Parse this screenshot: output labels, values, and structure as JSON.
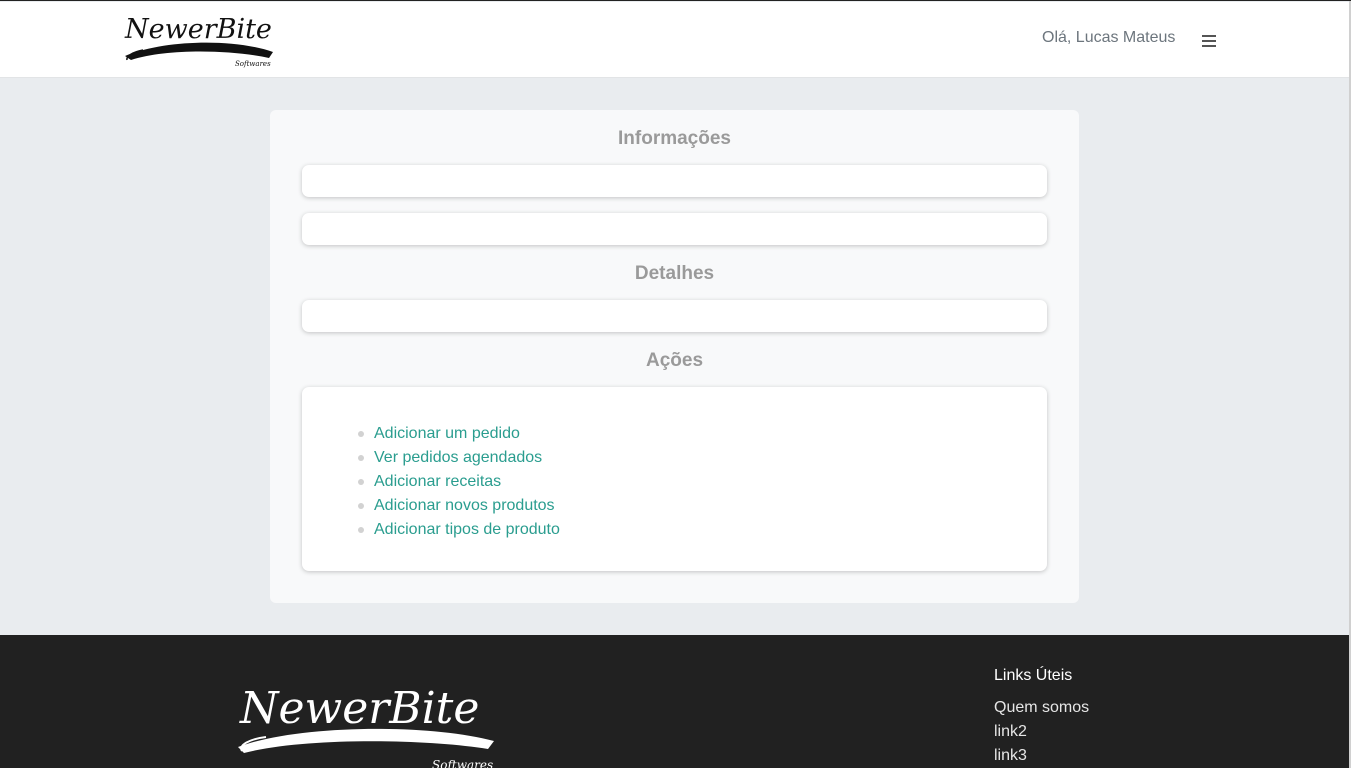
{
  "header": {
    "brand_name": "NewerBite",
    "brand_tagline": "Softwares",
    "greeting": "Olá, Lucas Mateus",
    "menu_icon": "hamburger-icon"
  },
  "main": {
    "sections": {
      "info_title": "Informações",
      "details_title": "Detalhes",
      "actions_title": "Ações"
    },
    "actions": [
      {
        "label": "Adicionar um pedido"
      },
      {
        "label": "Ver pedidos agendados"
      },
      {
        "label": "Adicionar receitas"
      },
      {
        "label": "Adicionar novos produtos"
      },
      {
        "label": "Adicionar tipos de produto"
      }
    ]
  },
  "footer": {
    "brand_name": "NewerBite",
    "brand_tagline": "Softwares",
    "links_title": "Links Úteis",
    "links": [
      {
        "label": "Quem somos"
      },
      {
        "label": "link2"
      },
      {
        "label": "link3"
      }
    ]
  },
  "colors": {
    "link": "#2a9d8f",
    "background": "#e9ecef",
    "card": "#f8f9fa",
    "footer": "#212121"
  }
}
